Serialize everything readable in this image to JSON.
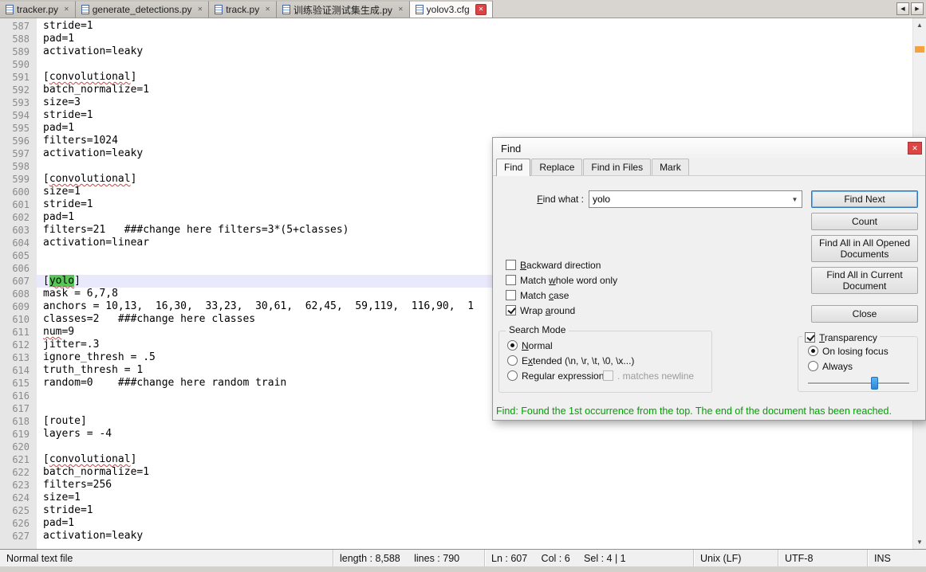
{
  "icons": {
    "tab_scroll_left": "◀",
    "tab_scroll_right": "▶",
    "scroll_up": "▲",
    "scroll_down": "▼",
    "dialog_close": "✕",
    "tab_close": "✕",
    "combo_arrow": "▼"
  },
  "colors": {
    "match_highlight": "#58c558",
    "current_line": "#e9e9fb",
    "misspell_underline": "#e03c3c"
  },
  "tabs": [
    {
      "label": "tracker.py",
      "active": false
    },
    {
      "label": "generate_detections.py",
      "active": false
    },
    {
      "label": "track.py",
      "active": false
    },
    {
      "label": "训练验证测试集生成.py",
      "active": false
    },
    {
      "label": "yolov3.cfg",
      "active": true
    }
  ],
  "editor": {
    "lines": [
      {
        "num": "587",
        "segments": [
          {
            "t": "stride=1"
          }
        ]
      },
      {
        "num": "588",
        "segments": [
          {
            "t": "pad=1"
          }
        ]
      },
      {
        "num": "589",
        "segments": [
          {
            "t": "activation=leaky"
          }
        ]
      },
      {
        "num": "590",
        "segments": []
      },
      {
        "num": "591",
        "segments": [
          {
            "t": "["
          },
          {
            "t": "convolutional",
            "s": "misspell"
          },
          {
            "t": "]"
          }
        ]
      },
      {
        "num": "592",
        "segments": [
          {
            "t": "batch_normalize=1"
          }
        ]
      },
      {
        "num": "593",
        "segments": [
          {
            "t": "size=3"
          }
        ]
      },
      {
        "num": "594",
        "segments": [
          {
            "t": "stride=1"
          }
        ]
      },
      {
        "num": "595",
        "segments": [
          {
            "t": "pad=1"
          }
        ]
      },
      {
        "num": "596",
        "segments": [
          {
            "t": "filters=1024"
          }
        ]
      },
      {
        "num": "597",
        "segments": [
          {
            "t": "activation=leaky"
          }
        ]
      },
      {
        "num": "598",
        "segments": []
      },
      {
        "num": "599",
        "segments": [
          {
            "t": "["
          },
          {
            "t": "convolutional",
            "s": "misspell"
          },
          {
            "t": "]"
          }
        ]
      },
      {
        "num": "600",
        "segments": [
          {
            "t": "size=1"
          }
        ]
      },
      {
        "num": "601",
        "segments": [
          {
            "t": "stride=1"
          }
        ]
      },
      {
        "num": "602",
        "segments": [
          {
            "t": "pad=1"
          }
        ]
      },
      {
        "num": "603",
        "segments": [
          {
            "t": "filters=21   ###change here filters=3*(5+classes)"
          }
        ]
      },
      {
        "num": "604",
        "segments": [
          {
            "t": "activation=linear"
          }
        ]
      },
      {
        "num": "605",
        "segments": []
      },
      {
        "num": "606",
        "segments": []
      },
      {
        "num": "607",
        "current": true,
        "segments": [
          {
            "t": "["
          },
          {
            "t": "yolo",
            "s": "match misspell"
          },
          {
            "t": "]"
          }
        ]
      },
      {
        "num": "608",
        "segments": [
          {
            "t": "mask = 6,7,8"
          }
        ]
      },
      {
        "num": "609",
        "segments": [
          {
            "t": "anchors = 10,13,  16,30,  33,23,  30,61,  62,45,  59,119,  116,90,  1"
          }
        ]
      },
      {
        "num": "610",
        "segments": [
          {
            "t": "classes=2   ###change here classes"
          }
        ]
      },
      {
        "num": "611",
        "segments": [
          {
            "t": "num",
            "s": "misspell"
          },
          {
            "t": "=9"
          }
        ]
      },
      {
        "num": "612",
        "segments": [
          {
            "t": "jitter=.3"
          }
        ]
      },
      {
        "num": "613",
        "segments": [
          {
            "t": "ignore_thresh = .5"
          }
        ]
      },
      {
        "num": "614",
        "segments": [
          {
            "t": "truth_thresh = 1"
          }
        ]
      },
      {
        "num": "615",
        "segments": [
          {
            "t": "random=0    ###change here random train"
          }
        ]
      },
      {
        "num": "616",
        "segments": []
      },
      {
        "num": "617",
        "segments": []
      },
      {
        "num": "618",
        "segments": [
          {
            "t": "[route]"
          }
        ]
      },
      {
        "num": "619",
        "segments": [
          {
            "t": "layers = -4"
          }
        ]
      },
      {
        "num": "620",
        "segments": []
      },
      {
        "num": "621",
        "segments": [
          {
            "t": "["
          },
          {
            "t": "convolutional",
            "s": "misspell"
          },
          {
            "t": "]"
          }
        ]
      },
      {
        "num": "622",
        "segments": [
          {
            "t": "batch_normalize=1"
          }
        ]
      },
      {
        "num": "623",
        "segments": [
          {
            "t": "filters=256"
          }
        ]
      },
      {
        "num": "624",
        "segments": [
          {
            "t": "size=1"
          }
        ]
      },
      {
        "num": "625",
        "segments": [
          {
            "t": "stride=1"
          }
        ]
      },
      {
        "num": "626",
        "segments": [
          {
            "t": "pad=1"
          }
        ]
      },
      {
        "num": "627",
        "segments": [
          {
            "t": "activation=leaky"
          }
        ]
      }
    ]
  },
  "find_dialog": {
    "title": "Find",
    "tabs": [
      {
        "label": "Find",
        "active": true
      },
      {
        "label": "Replace",
        "active": false
      },
      {
        "label": "Find in Files",
        "active": false
      },
      {
        "label": "Mark",
        "active": false
      }
    ],
    "find_what_label": "Find what :",
    "find_what_ak": 0,
    "find_what_value": "yolo",
    "buttons": [
      {
        "label": "Find Next",
        "default": true
      },
      {
        "label": "Count"
      },
      {
        "label": "Find All in All Opened Documents"
      },
      {
        "label": "Find All in Current Document"
      },
      {
        "label": "Close"
      }
    ],
    "options": [
      {
        "label": "Backward direction",
        "ak": 0,
        "checked": false
      },
      {
        "label": "Match whole word only",
        "ak": 6,
        "checked": false
      },
      {
        "label": "Match case",
        "ak": 6,
        "checked": false
      },
      {
        "label": "Wrap around",
        "ak": 5,
        "checked": true
      }
    ],
    "search_mode": {
      "title": "Search Mode",
      "radios": [
        {
          "label": "Normal",
          "ak": 0,
          "selected": true
        },
        {
          "label": "Extended (\\n, \\r, \\t, \\0, \\x...)",
          "ak": 1,
          "selected": false
        },
        {
          "label": "Regular expression",
          "ak": 2,
          "selected": false
        }
      ],
      "matches_newline": {
        "label": ". matches newline",
        "disabled": true,
        "checked": false
      }
    },
    "transparency": {
      "label": "Transparency",
      "ak": 0,
      "checked": true,
      "radios": [
        {
          "label": "On losing focus",
          "selected": true
        },
        {
          "label": "Always",
          "selected": false
        }
      ],
      "slider_percent": 65
    },
    "status_message": "Find: Found the 1st occurrence from the top. The end of the document has been reached.",
    "status_color": "#00a000"
  },
  "status_bar": {
    "doc_type": "Normal text file",
    "length_lines": "length : 8,588     lines : 790",
    "cursor": "Ln : 607     Col : 6     Sel : 4 | 1",
    "eol": "Unix (LF)",
    "encoding": "UTF-8",
    "mode": "INS"
  }
}
